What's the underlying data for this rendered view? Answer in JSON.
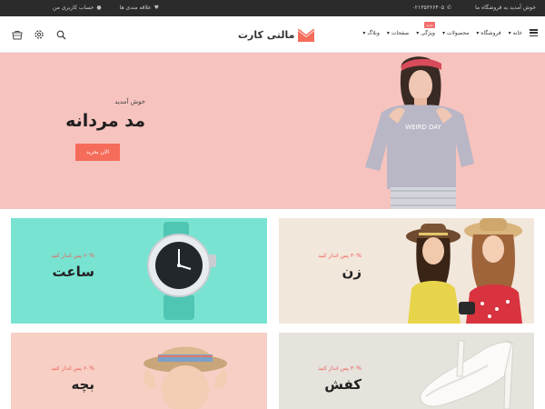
{
  "topbar": {
    "welcome": "خوش آمدید به فروشگاه ما",
    "phone": "۰۲۱۳۵۳۶۶۴۰۵",
    "wishlist": "علاقه مندی ها",
    "account": "حساب کاربری من"
  },
  "header": {
    "logo_text": "مالتی کارت",
    "nav": [
      {
        "label": "خانه"
      },
      {
        "label": "فروشگاه"
      },
      {
        "label": "محصولات"
      },
      {
        "label": "ویژگی",
        "badge": "جدید"
      },
      {
        "label": "صفحات"
      },
      {
        "label": "وبلاگ"
      }
    ],
    "icons": [
      "cart-icon",
      "settings-icon",
      "search-icon"
    ]
  },
  "hero": {
    "subtitle": "خوش آمدید",
    "title": "مد مردانه",
    "button": "الان بخرید",
    "shirt_text": "WEIRD DAY"
  },
  "tiles": {
    "watch": {
      "off": "۶۰% پس انداز کنید",
      "name": "ساعت"
    },
    "women": {
      "off": "۳۰% پس انداز کنید",
      "name": "زن"
    },
    "kids": {
      "off": "۶۰% پس انداز کنید",
      "name": "بچه"
    },
    "shoes": {
      "off": "۳۰% پس انداز کنید",
      "name": "کفش"
    }
  },
  "colors": {
    "accent": "#f56c5a",
    "hero_bg": "#f7c3be",
    "watch_bg": "#79e3d2",
    "women_bg": "#f2e7db",
    "kids_bg": "#f7cfc5",
    "shoes_bg": "#e6e2dc",
    "topbar_bg": "#2b2b2b"
  }
}
